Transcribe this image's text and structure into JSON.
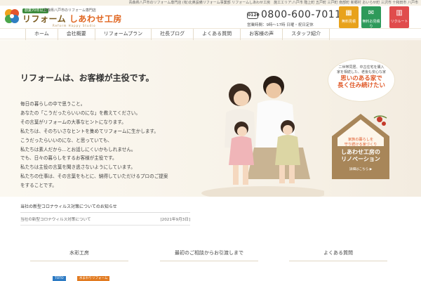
{
  "topbar": {
    "text": "青森県八戸市のリフォーム専門店 (有)北奥設備リフォーム事業部 リフォームしあわせ工房　施工エリア:八戸市 階上町 五戸町 三戸町 南部町 新郷村 おいらせ町 三沢市 十和田市 八戸市"
  },
  "header": {
    "badge": "創業70年以上",
    "logo_small": "青森県八戸市のリフォーム専門店",
    "logo_main_prefix": "リフォーム ",
    "logo_main_accent": "しあわせ工房",
    "logo_en": "Reform Happy Studio",
    "phone_icon": "0120",
    "phone": "0800-600-7011",
    "hours": "営業時間：9時〜17時 日曜・祝日定休",
    "buttons": [
      {
        "label": "無料見積",
        "icon": "calculator-icon",
        "color": "#e8a21b"
      },
      {
        "label": "無料お見積り",
        "icon": "mail-icon",
        "color": "#2e9a5a"
      },
      {
        "label": "リクルート",
        "icon": "building-icon",
        "color": "#e04c4c"
      }
    ]
  },
  "nav": {
    "items": [
      "ホーム",
      "会社概要",
      "リフォームプラン",
      "社長ブログ",
      "よくある質問",
      "お客様の声",
      "スタッフ紹介"
    ]
  },
  "hero": {
    "title": "リフォームは、お客様が主役です。",
    "lines": [
      "毎日の暮らしの中で思うこと。",
      "あなたの「こうだったらいいのにな」を教えてください。",
      "その言葉がリフォームの大事なヒントになります。",
      "私たちは、そのちいさなヒントを集めてリフォームに生かします。",
      "こうだったらいいのにな、と思っていても、",
      "私たちは素人だから…とお話しにくいかもしれません。",
      "でも、日々の暮らしをするお客様が主役です。",
      "私たちは主役の言葉を聞き逃さないようにしています。",
      "私たちの仕事は、その言葉をもとに、納得していただけるプロのご提案",
      "をすることです。"
    ],
    "bubble": {
      "small1": "二世帯同居、中古住宅を購入",
      "small2": "家を相続した、老後も安心な家",
      "big1": "思いのある家で",
      "big2": "長く住み続けたい"
    },
    "house": {
      "sub1": "家族の暮らしを",
      "sub2": "守り続ける家づくり",
      "main1": "しあわせ工房の",
      "main2": "リノベーション",
      "link": "詳細はこちら ▶"
    }
  },
  "news": {
    "title": "当社の新型コロナウィルス対策についてのお知らせ",
    "items": [
      {
        "text": "当社の新型コロナウィルス対策について",
        "date": "[2021年9月3日]"
      }
    ]
  },
  "sections": [
    {
      "title": "水彩工房"
    },
    {
      "title": "最初のご相談からお引渡しまで"
    },
    {
      "title": "よくある質問"
    }
  ],
  "thumbs": [
    {
      "text": "TOTO"
    },
    {
      "text": "水まわりリフォーム"
    }
  ]
}
